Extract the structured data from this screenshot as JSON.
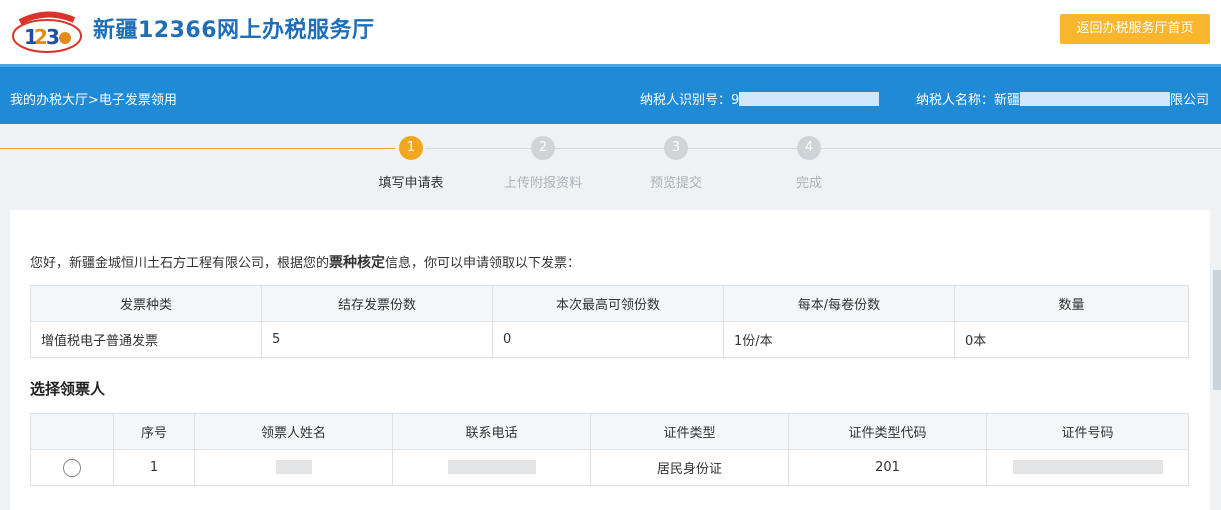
{
  "header": {
    "title": "新疆12366网上办税服务厅",
    "home_button": "返回办税服务厅首页"
  },
  "infobar": {
    "breadcrumb": "我的办税大厅>电子发票领用",
    "taxid_label": "纳税人识别号：9",
    "taxname_label": "纳税人名称：新疆",
    "taxname_suffix": "限公司"
  },
  "steps": [
    {
      "num": "1",
      "label": "填写申请表"
    },
    {
      "num": "2",
      "label": "上传附报资料"
    },
    {
      "num": "3",
      "label": "预览提交"
    },
    {
      "num": "4",
      "label": "完成"
    }
  ],
  "greeting": {
    "before": "您好，新疆金城恒川土石方工程有限公司，根据您的",
    "bold": "票种核定",
    "after": "信息，你可以申请领取以下发票："
  },
  "invoice_table": {
    "headers": [
      "发票种类",
      "结存发票份数",
      "本次最高可领份数",
      "每本/每卷份数",
      "数量"
    ],
    "row": [
      "增值税电子普通发票",
      "5",
      "0",
      "1份/本",
      "0本"
    ]
  },
  "receiver_section": {
    "title": "选择领票人",
    "headers": [
      "",
      "序号",
      "领票人姓名",
      "联系电话",
      "证件类型",
      "证件类型代码",
      "证件号码"
    ],
    "rows": [
      {
        "index": "1",
        "id_type": "居民身份证",
        "id_code": "201"
      }
    ]
  }
}
